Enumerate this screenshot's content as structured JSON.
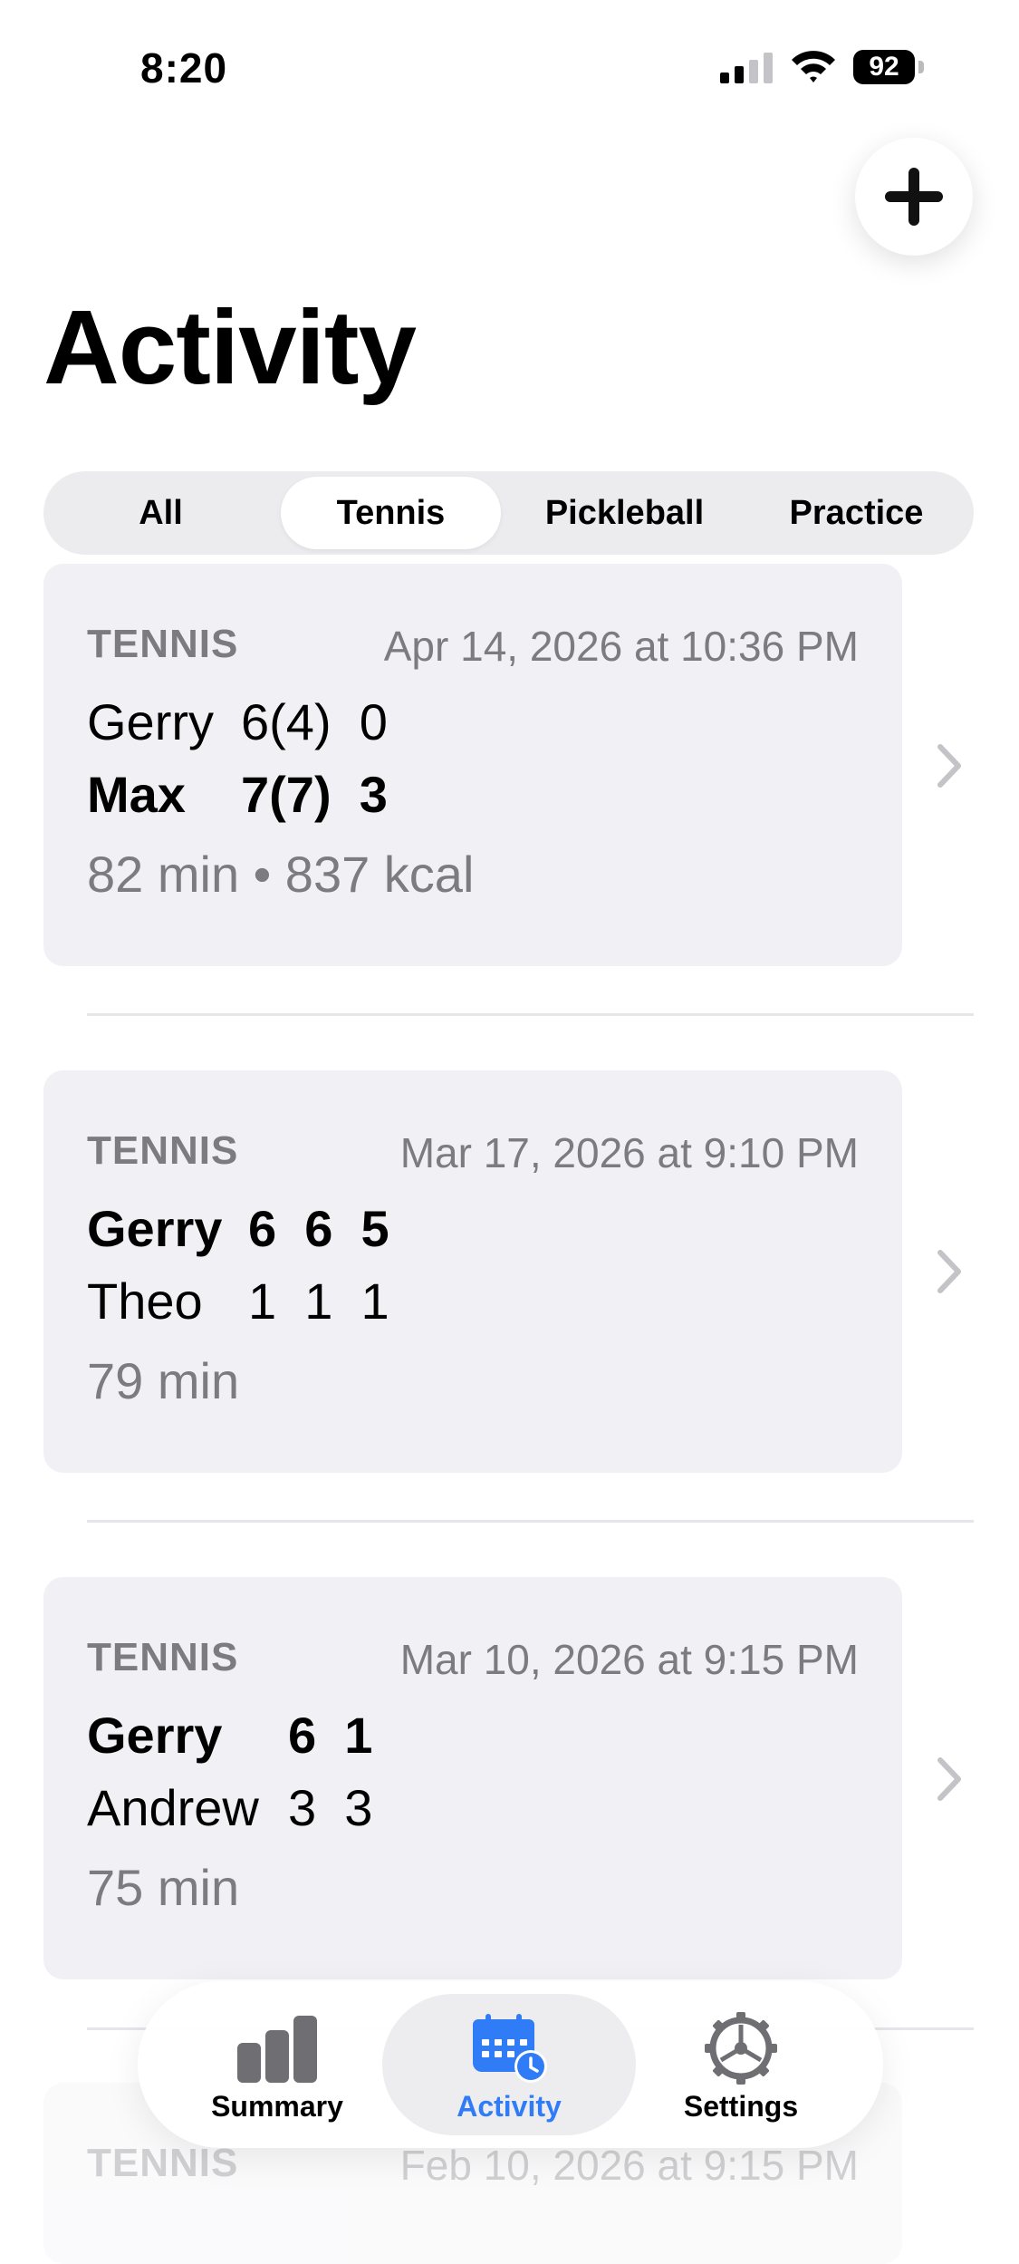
{
  "status_bar": {
    "time": "8:20",
    "battery": "92"
  },
  "header": {
    "title": "Activity",
    "add_icon": "plus-icon"
  },
  "filter": {
    "segments": [
      "All",
      "Tennis",
      "Pickleball",
      "Practice"
    ],
    "selected": "Tennis"
  },
  "activities": [
    {
      "sport": "TENNIS",
      "date": "Apr 14, 2026 at 10:36 PM",
      "players": [
        {
          "name": "Gerry",
          "score": "6(4)  0"
        },
        {
          "name": "Max",
          "score": "7(7)  3"
        }
      ],
      "meta": "82 min • 837 kcal"
    },
    {
      "sport": "TENNIS",
      "date": "Mar 17, 2026 at 9:10 PM",
      "players": [
        {
          "name": "Gerry",
          "score": "6  6  5"
        },
        {
          "name": "Theo",
          "score": "1  1  1"
        }
      ],
      "meta": "79 min"
    },
    {
      "sport": "TENNIS",
      "date": "Mar 10, 2026 at 9:15 PM",
      "players": [
        {
          "name": "Gerry",
          "score": "6  1"
        },
        {
          "name": "Andrew",
          "score": "3  3"
        }
      ],
      "meta": "75 min"
    },
    {
      "sport": "TENNIS",
      "date": "Feb 10, 2026 at 9:15 PM"
    }
  ],
  "tab_bar": {
    "tabs": [
      {
        "label": "Summary",
        "icon": "bar-chart-icon"
      },
      {
        "label": "Activity",
        "icon": "calendar-clock-icon"
      },
      {
        "label": "Settings",
        "icon": "gear-icon"
      }
    ],
    "selected": "Activity",
    "accent": "#2f7cf6"
  },
  "colors": {
    "secondary_text": "#7c7c80",
    "card_bg": "#f1f1f5",
    "control_bg": "#ececef"
  }
}
